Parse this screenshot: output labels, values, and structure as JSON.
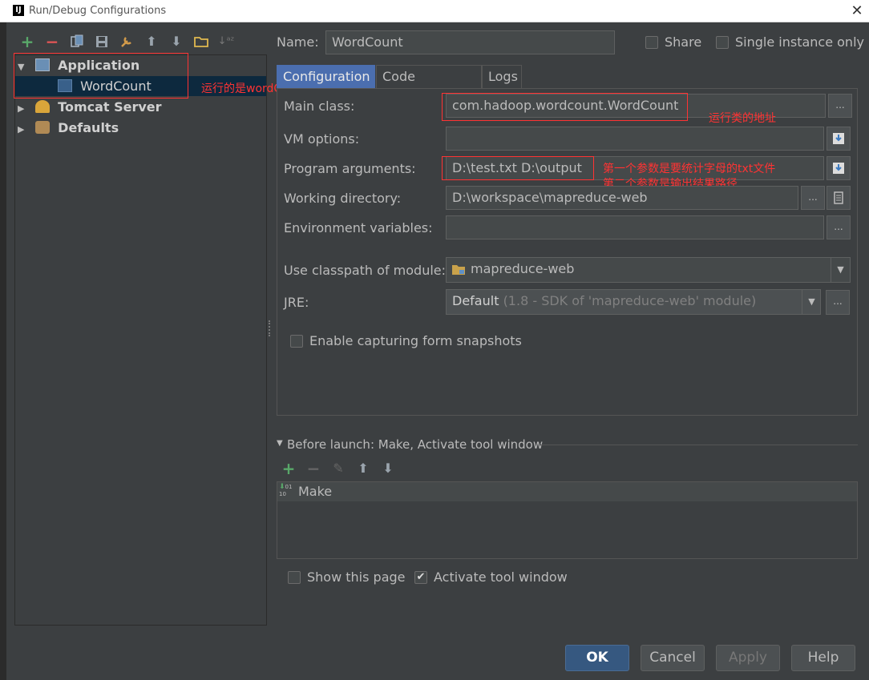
{
  "window": {
    "title": "Run/Debug Configurations",
    "app_icon": "intellij-icon",
    "close_glyph": "✕"
  },
  "toolbar": {
    "icons": [
      "add-icon",
      "remove-icon",
      "copy-icon",
      "save-icon",
      "wrench-icon",
      "move-up-icon",
      "move-down-icon",
      "folder-icon",
      "sort-icon"
    ]
  },
  "tree": {
    "application": "Application",
    "wordcount": "WordCount",
    "tomcat": "Tomcat Server",
    "defaults": "Defaults"
  },
  "annotations": {
    "main_func": "运行的是wordCount的main函数",
    "main_class": "运行类的地址",
    "args_line1": "第一个参数是要统计字母的txt文件",
    "args_line2": "第二个参数是输出结果路径"
  },
  "header": {
    "name_label": "Name:",
    "name_value": "WordCount",
    "share_label": "Share",
    "single_instance_label": "Single instance only"
  },
  "tabs": [
    "Configuration",
    "Code Coverage",
    "Logs"
  ],
  "form": {
    "main_class_label": "Main class:",
    "main_class_value": "com.hadoop.wordcount.WordCount",
    "vm_options_label": "VM options:",
    "vm_options_value": "",
    "program_args_label": "Program arguments:",
    "program_args_value": "D:\\test.txt D:\\output",
    "working_dir_label": "Working directory:",
    "working_dir_value": "D:\\workspace\\mapreduce-web",
    "env_vars_label": "Environment variables:",
    "env_vars_value": "",
    "classpath_label": "Use classpath of module:",
    "classpath_value": "mapreduce-web",
    "jre_label": "JRE:",
    "jre_value": "Default",
    "jre_detail": "(1.8 - SDK of 'mapreduce-web' module)",
    "snapshots_label": "Enable capturing form snapshots",
    "ellipsis": "..."
  },
  "before_launch": {
    "title": "Before launch: Make, Activate tool window",
    "items": [
      "Make"
    ]
  },
  "footer": {
    "show_page_label": "Show this page",
    "activate_label": "Activate tool window",
    "ok": "OK",
    "cancel": "Cancel",
    "apply": "Apply",
    "help": "Help"
  },
  "colors": {
    "accent_green": "#59a869",
    "accent_red": "#e05555",
    "annotation_red": "#ff3333",
    "selection": "#0d293e",
    "ok_button": "#365880"
  }
}
